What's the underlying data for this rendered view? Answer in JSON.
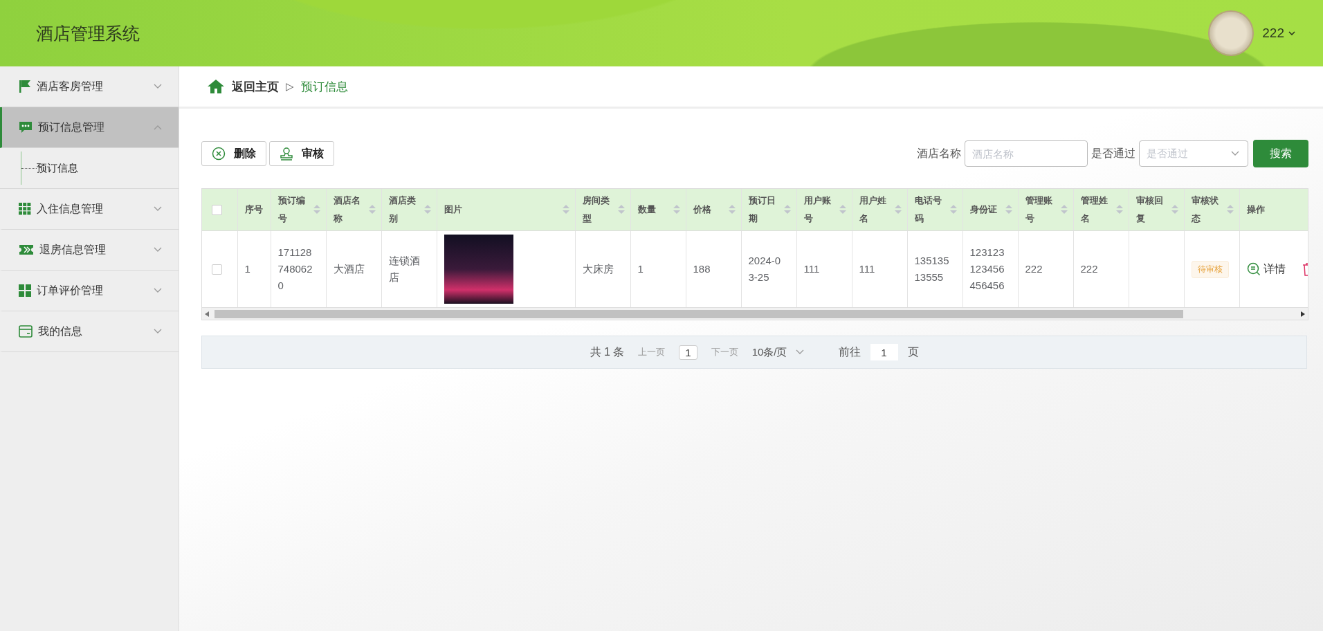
{
  "header": {
    "title": "酒店管理系统",
    "user": "222"
  },
  "sidebar": {
    "items": [
      {
        "label": "酒店客房管理",
        "expanded": false,
        "selected": false
      },
      {
        "label": "预订信息管理",
        "expanded": true,
        "selected": true,
        "children": [
          {
            "label": "预订信息"
          }
        ]
      },
      {
        "label": "入住信息管理",
        "expanded": false,
        "selected": false
      },
      {
        "label": "退房信息管理",
        "expanded": false,
        "selected": false
      },
      {
        "label": "订单评价管理",
        "expanded": false,
        "selected": false
      },
      {
        "label": "我的信息",
        "expanded": false,
        "selected": false
      }
    ]
  },
  "breadcrumb": {
    "home": "返回主页",
    "separator": "▷",
    "current": "预订信息"
  },
  "toolbar": {
    "buttons": [
      {
        "label": "删除"
      },
      {
        "label": "审核"
      }
    ]
  },
  "search": {
    "fields": [
      {
        "label": "酒店名称",
        "placeholder": "酒店名称",
        "kind": "input"
      },
      {
        "label": "是否通过",
        "placeholder": "是否通过",
        "kind": "select"
      }
    ],
    "button": "搜索"
  },
  "table": {
    "select_all_checked": false,
    "columns": [
      {
        "label": "序号",
        "sortable": false
      },
      {
        "label": "预订编号",
        "sortable": true
      },
      {
        "label": "酒店名称",
        "sortable": true
      },
      {
        "label": "酒店类别",
        "sortable": true
      },
      {
        "label": "图片",
        "sortable": true
      },
      {
        "label": "房间类型",
        "sortable": true
      },
      {
        "label": "数量",
        "sortable": true
      },
      {
        "label": "价格",
        "sortable": true
      },
      {
        "label": "预订日期",
        "sortable": true
      },
      {
        "label": "用户账号",
        "sortable": true
      },
      {
        "label": "用户姓名",
        "sortable": true
      },
      {
        "label": "电话号码",
        "sortable": true
      },
      {
        "label": "身份证",
        "sortable": true
      },
      {
        "label": "管理账号",
        "sortable": true
      },
      {
        "label": "管理姓名",
        "sortable": true
      },
      {
        "label": "审核回复",
        "sortable": true
      },
      {
        "label": "审核状态",
        "sortable": true
      },
      {
        "label": "操作",
        "sortable": false
      }
    ],
    "rows": [
      {
        "checked": false,
        "index": "1",
        "booking_no": "1711287480620",
        "hotel_name": "大酒店",
        "hotel_type": "连锁酒店",
        "room_type": "大床房",
        "quantity": "1",
        "price": "188",
        "booking_date": "2024-03-25",
        "user_account": "111",
        "user_name": "111",
        "phone": "13513513555",
        "id_card": "123123123456456456",
        "admin_account": "222",
        "admin_name": "222",
        "review_reply": "",
        "review_status": "待审核",
        "action": "详情"
      }
    ]
  },
  "pagination": {
    "total": "共 1 条",
    "prev": "上一页",
    "page": "1",
    "next": "下一页",
    "page_size": "10条/页",
    "goto": "前往",
    "goto_value": "1",
    "goto_suffix": "页"
  }
}
